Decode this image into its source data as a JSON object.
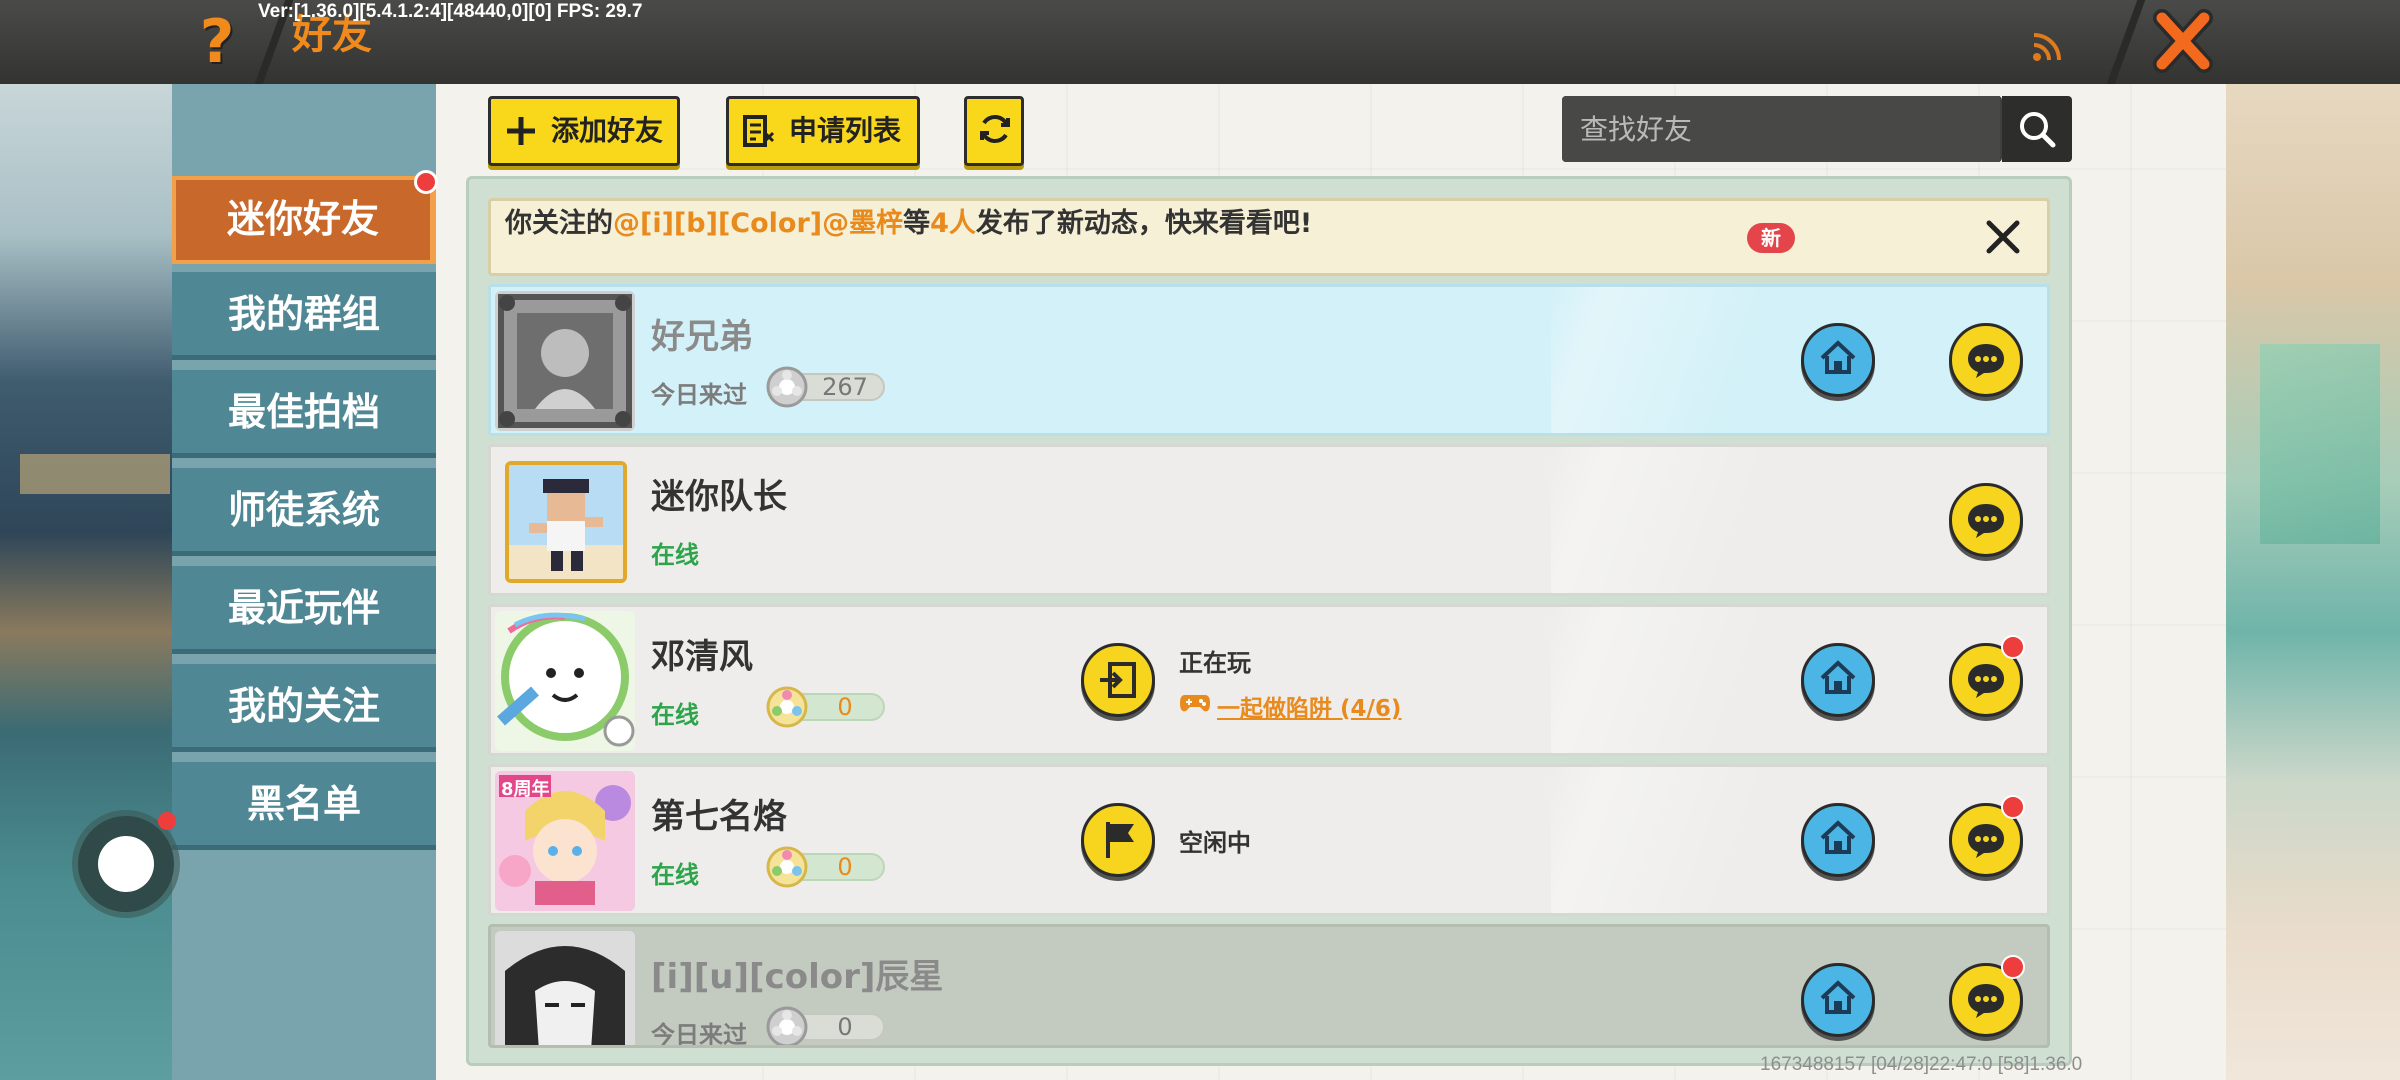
{
  "debug": "Ver:[1.36.0][5.4.1.2:4][48440,0][0] FPS: 29.7",
  "header": {
    "title": "好友",
    "help_icon": "question-mark-icon",
    "rss_icon": "rss-icon",
    "close_icon": "close-x-icon"
  },
  "sidebar": {
    "tabs": [
      {
        "label": "迷你好友",
        "active": true
      },
      {
        "label": "我的群组",
        "active": false
      },
      {
        "label": "最佳拍档",
        "active": false
      },
      {
        "label": "师徒系统",
        "active": false
      },
      {
        "label": "最近玩伴",
        "active": false
      },
      {
        "label": "我的关注",
        "active": false
      },
      {
        "label": "黑名单",
        "active": false
      }
    ]
  },
  "toolbar": {
    "add_friend": "添加好友",
    "apply_list": "申请列表",
    "refresh_icon": "refresh-icon"
  },
  "search": {
    "placeholder": "查找好友",
    "icon": "search-icon"
  },
  "notice": {
    "prefix": "你关注的",
    "name": "@[i][b][Color]@墨梓",
    "middle": "等",
    "count": "4人",
    "suffix": "发布了新动态，快来看看吧!",
    "badge": "新"
  },
  "friends": [
    {
      "name": "好兄弟",
      "status": "今日来过",
      "coins": "267",
      "style": "highlight"
    },
    {
      "name": "迷你队长",
      "status": "在线"
    },
    {
      "name": "邓清风",
      "status": "在线",
      "coins": "0",
      "activity_label": "正在玩",
      "activity_game": "一起做陷阱 (4/6)"
    },
    {
      "name": "第七名烙",
      "status": "在线",
      "coins": "0",
      "activity_label": "空闲中"
    },
    {
      "name": "[i][u][color]辰星",
      "status": "今日来过",
      "coins": "0",
      "style": "faded"
    }
  ],
  "footer": "1673488157  [04/28]22:47:0  [58]1.36.0",
  "colors": {
    "accent_orange": "#f08a1c",
    "button_yellow": "#f9d81c",
    "home_blue": "#4bb6e6",
    "online_green": "#2da44a",
    "tab_teal": "#4f8794",
    "tab_active": "#c8682a"
  }
}
